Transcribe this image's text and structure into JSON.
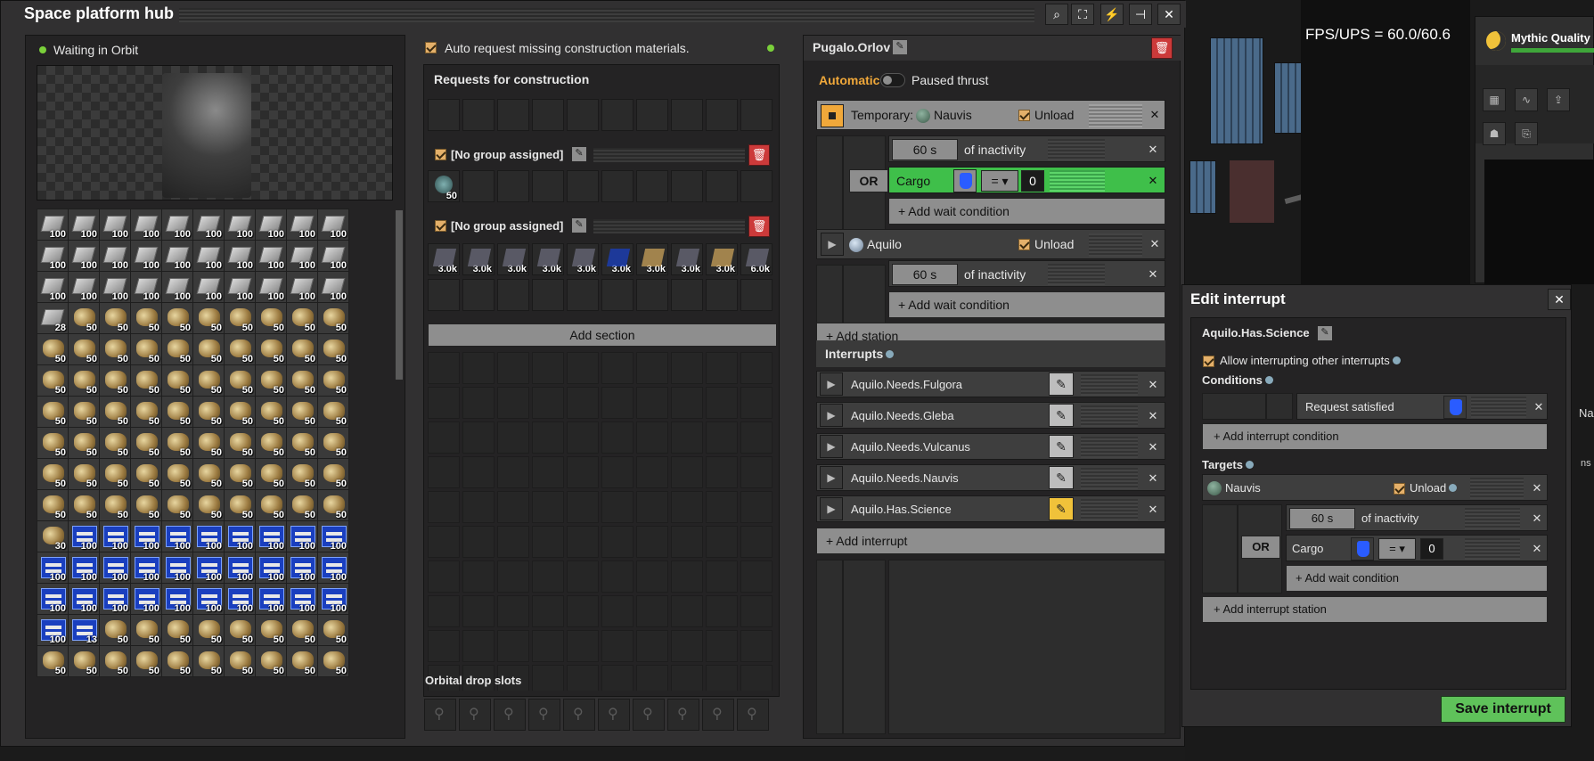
{
  "window": {
    "title": "Space platform hub"
  },
  "toolbar": [
    "search",
    "network",
    "bolt",
    "pin",
    "close"
  ],
  "status": {
    "text": "Waiting in Orbit",
    "color": "#7ad03a"
  },
  "inventory": {
    "rows": [
      [
        "100",
        "100",
        "100",
        "100",
        "100",
        "100",
        "100",
        "100",
        "100",
        "100"
      ],
      [
        "100",
        "100",
        "100",
        "100",
        "100",
        "100",
        "100",
        "100",
        "100",
        "100"
      ],
      [
        "100",
        "100",
        "100",
        "100",
        "100",
        "100",
        "100",
        "100",
        "100",
        "100"
      ],
      [
        "28",
        "50",
        "50",
        "50",
        "50",
        "50",
        "50",
        "50",
        "50",
        "50"
      ],
      [
        "50",
        "50",
        "50",
        "50",
        "50",
        "50",
        "50",
        "50",
        "50",
        "50"
      ],
      [
        "50",
        "50",
        "50",
        "50",
        "50",
        "50",
        "50",
        "50",
        "50",
        "50"
      ],
      [
        "50",
        "50",
        "50",
        "50",
        "50",
        "50",
        "50",
        "50",
        "50",
        "50"
      ],
      [
        "50",
        "50",
        "50",
        "50",
        "50",
        "50",
        "50",
        "50",
        "50",
        "50"
      ],
      [
        "50",
        "50",
        "50",
        "50",
        "50",
        "50",
        "50",
        "50",
        "50",
        "50"
      ],
      [
        "50",
        "50",
        "50",
        "50",
        "50",
        "50",
        "50",
        "50",
        "50",
        "50"
      ],
      [
        "30",
        "100",
        "100",
        "100",
        "100",
        "100",
        "100",
        "100",
        "100",
        "100"
      ],
      [
        "100",
        "100",
        "100",
        "100",
        "100",
        "100",
        "100",
        "100",
        "100",
        "100"
      ],
      [
        "100",
        "100",
        "100",
        "100",
        "100",
        "100",
        "100",
        "100",
        "100",
        "100"
      ],
      [
        "100",
        "13",
        "50",
        "50",
        "50",
        "50",
        "50",
        "50",
        "50",
        "50"
      ],
      [
        "50",
        "50",
        "50",
        "50",
        "50",
        "50",
        "50",
        "50",
        "50",
        "50"
      ]
    ],
    "types": [
      "pppppppppp",
      "pppppppppp",
      "pppppppppp",
      "pooooooooo",
      "oooooooooo",
      "oooooooooo",
      "oooooooooo",
      "oooooooooo",
      "oooooooooo",
      "oooooooooo",
      "occccccccc",
      "cccccccccc",
      "cccccccccc",
      "ccoooooooo",
      "oooooooooo"
    ]
  },
  "requests": {
    "auto_label": "Auto request missing construction materials.",
    "header": "Requests for construction",
    "section1": {
      "label": "[No group assigned]",
      "counts": [
        "50"
      ]
    },
    "section2": {
      "label": "[No group assigned]",
      "counts": [
        "3.0k",
        "3.0k",
        "3.0k",
        "3.0k",
        "3.0k",
        "3.0k",
        "3.0k",
        "3.0k",
        "3.0k",
        "6.0k"
      ]
    },
    "add_section": "Add section",
    "orbital": "Orbital drop slots"
  },
  "schedule": {
    "name": "Pugalo.Orlov",
    "automatic": "Automatic",
    "paused": "Paused thrust",
    "stop1": {
      "prefix": "Temporary:",
      "planet": "Nauvis",
      "unload": "Unload"
    },
    "or": "OR",
    "inactivity": "of inactivity",
    "sec60": "60 s",
    "cargo": "Cargo",
    "eq": "=",
    "zero": "0",
    "add_wait": "+ Add wait condition",
    "stop2": {
      "planet": "Aquilo",
      "unload": "Unload"
    },
    "add_station": "+ Add station",
    "interrupts_label": "Interrupts",
    "interrupts": [
      "Aquilo.Needs.Fulgora",
      "Aquilo.Needs.Gleba",
      "Aquilo.Needs.Vulcanus",
      "Aquilo.Needs.Nauvis",
      "Aquilo.Has.Science"
    ],
    "add_interrupt": "+ Add interrupt"
  },
  "hud": {
    "fps": "FPS/UPS = 60.0/60.6",
    "quality": "Mythic Quality",
    "na": "Na",
    "ns": "ns"
  },
  "edit_interrupt": {
    "title": "Edit interrupt",
    "name": "Aquilo.Has.Science",
    "allow": "Allow interrupting other interrupts",
    "conditions": "Conditions",
    "request_satisfied": "Request satisfied",
    "add_condition": "+ Add interrupt condition",
    "targets": "Targets",
    "target_planet": "Nauvis",
    "unload": "Unload",
    "sec60": "60 s",
    "inactivity": "of inactivity",
    "or": "OR",
    "cargo": "Cargo",
    "eq": "=",
    "zero": "0",
    "add_wait": "+ Add wait condition",
    "add_station": "+ Add interrupt station",
    "save": "Save interrupt"
  }
}
